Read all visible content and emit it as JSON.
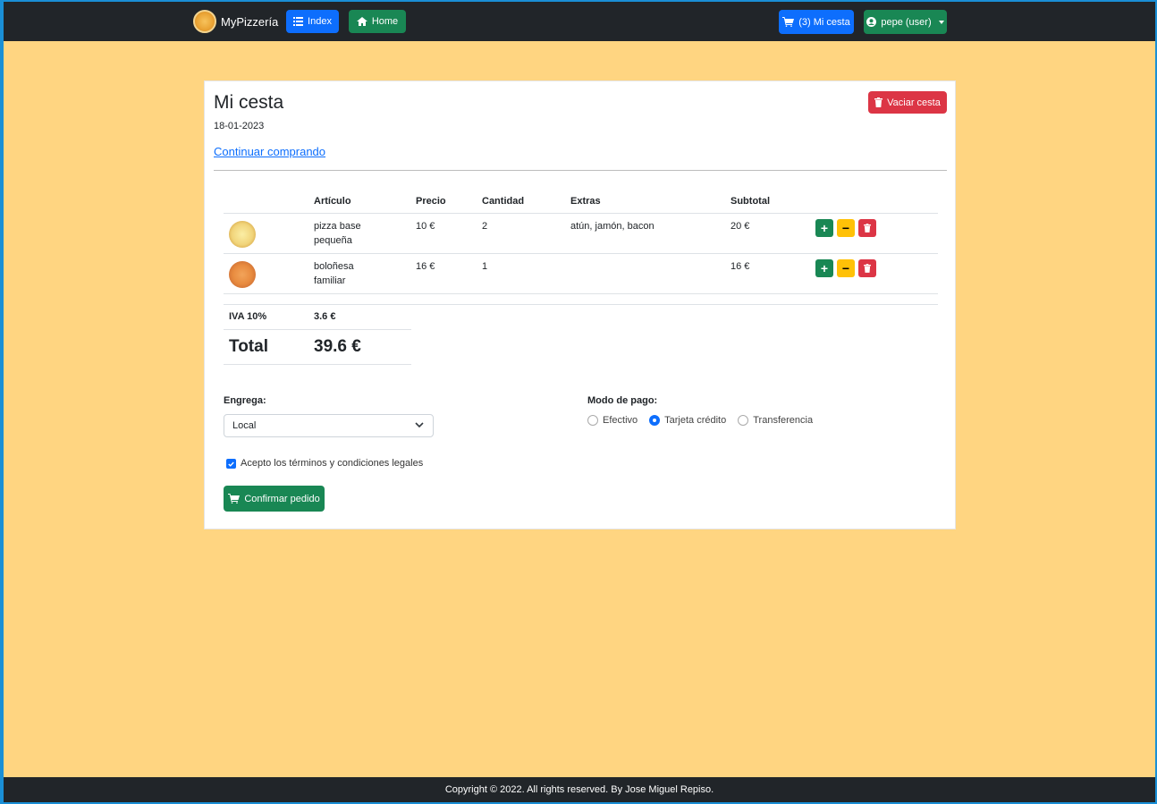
{
  "navbar": {
    "brand": "MyPizzería",
    "index_label": "Index",
    "home_label": "Home",
    "cart_label": "(3) Mi cesta",
    "user_label": "pepe (user)"
  },
  "cart": {
    "title": "Mi cesta",
    "date": "18-01-2023",
    "continue_link": "Continuar comprando",
    "empty_label": "Vaciar cesta",
    "columns": [
      "Artículo",
      "Precio",
      "Cantidad",
      "Extras",
      "Subtotal"
    ],
    "rows": [
      {
        "article": "pizza base pequeña",
        "price": "10 €",
        "quantity": "2",
        "extras": "atún, jamón, bacon",
        "subtotal": "20 €"
      },
      {
        "article": "boloñesa familiar",
        "price": "16 €",
        "quantity": "1",
        "extras": "",
        "subtotal": "16 €"
      }
    ],
    "iva_label": "IVA 10%",
    "iva_value": "3.6 €",
    "total_label": "Total",
    "total_value": "39.6 €"
  },
  "form": {
    "delivery_label": "Engrega:",
    "delivery_value": "Local",
    "payment_label": "Modo de pago:",
    "payment_options": [
      "Efectivo",
      "Tarjeta crédito",
      "Transferencia"
    ],
    "payment_selected": "Tarjeta crédito",
    "terms_label": "Acepto los términos y condiciones legales",
    "terms_checked": true,
    "confirm_label": "Confirmar pedido"
  },
  "footer": {
    "text": "Copyright © 2022. All rights reserved. By Jose Miguel Repiso."
  },
  "colors": {
    "background": "#ffd581",
    "navbar": "#212529",
    "primary": "#0d6efd",
    "success": "#198754",
    "danger": "#dc3545",
    "warning": "#ffc107"
  }
}
